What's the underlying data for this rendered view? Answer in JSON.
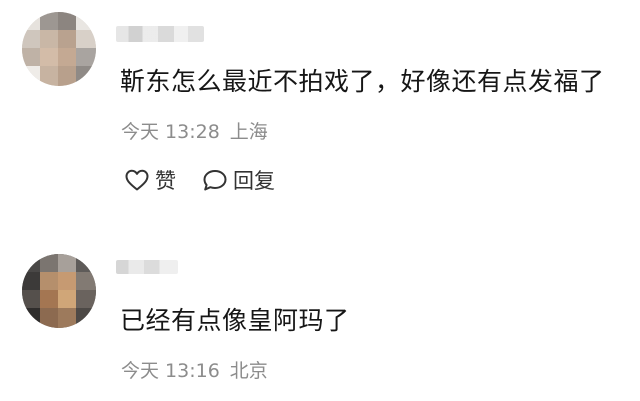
{
  "comments": [
    {
      "text": "靳东怎么最近不拍戏了，好像还有点发福了",
      "time": "今天 13:28",
      "location": "上海",
      "actions": {
        "like": "赞",
        "reply": "回复"
      }
    },
    {
      "text": "已经有点像皇阿玛了",
      "time": "今天 13:16",
      "location": "北京"
    }
  ],
  "colors": {
    "text": "#161616",
    "meta": "#8c8c8c",
    "background": "#ffffff"
  },
  "icons": {
    "like": "heart-outline-icon",
    "reply": "speech-bubble-outline-icon"
  }
}
